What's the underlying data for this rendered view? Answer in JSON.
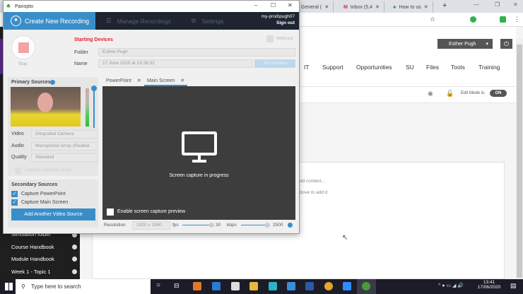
{
  "browser": {
    "tabs": [
      {
        "label": "General (",
        "icon": "teams-icon"
      },
      {
        "label": "Inbox (5,4",
        "icon": "gmail-icon"
      },
      {
        "label": "How to us",
        "icon": "panopto-icon"
      }
    ],
    "user_menu": "Esther Pugh",
    "nav": [
      "IT",
      "Support",
      "Opportunities",
      "SU",
      "Files",
      "Tools",
      "Training"
    ],
    "edit_mode_label": "Edit Mode is:",
    "edit_mode_value": "ON",
    "content_hint_1": "dd content...",
    "content_hint_2": "bove to add it.",
    "sidebar_items": [
      "Simulation folder",
      "Course Handbook",
      "Module Handbook",
      "Week 1 - Topic 1"
    ]
  },
  "panopto": {
    "title": "Panopto",
    "tabs": {
      "create": "Create New Recording",
      "manage": "Manage Recordings",
      "settings": "Settings"
    },
    "account": "my-prod\\pugh07",
    "sign_out": "Sign out",
    "status": "Starting Devices",
    "webcast": "Webcast",
    "stop": "Stop",
    "folder_label": "Folder",
    "folder_value": "Esther Pugh",
    "name_label": "Name",
    "name_value": "17 June 2020 at 13:39:32",
    "join_session": "Join Session",
    "primary_sources": "Primary Sources",
    "video_label": "Video",
    "video_value": "Integrated Camera",
    "audio_label": "Audio",
    "audio_value": "Microphone Array (Realtek",
    "quality_label": "Quality",
    "quality_value": "Standard",
    "capture_computer_audio": "Capture Computer Audio",
    "secondary_sources": "Secondary Sources",
    "capture_powerpoint": "Capture PowerPoint",
    "capture_main_screen": "Capture Main Screen",
    "add_source": "Add Another Video Source",
    "preview_tabs": [
      "PowerPoint",
      "Main Screen"
    ],
    "capture_status": "Screen capture in progress",
    "enable_preview": "Enable screen capture preview",
    "resolution_label": "Resolution",
    "resolution_value": "1920 x 1080",
    "fps_label": "fps",
    "fps_value": "30",
    "kbps_label": "kbps",
    "kbps_value": "2500"
  },
  "taskbar": {
    "search_placeholder": "Type here to search",
    "time": "13:41",
    "date": "17/06/2020"
  },
  "colors": {
    "accent": "#3a8ec8",
    "status_red": "#d9232e",
    "header_dark": "#1e2530"
  }
}
